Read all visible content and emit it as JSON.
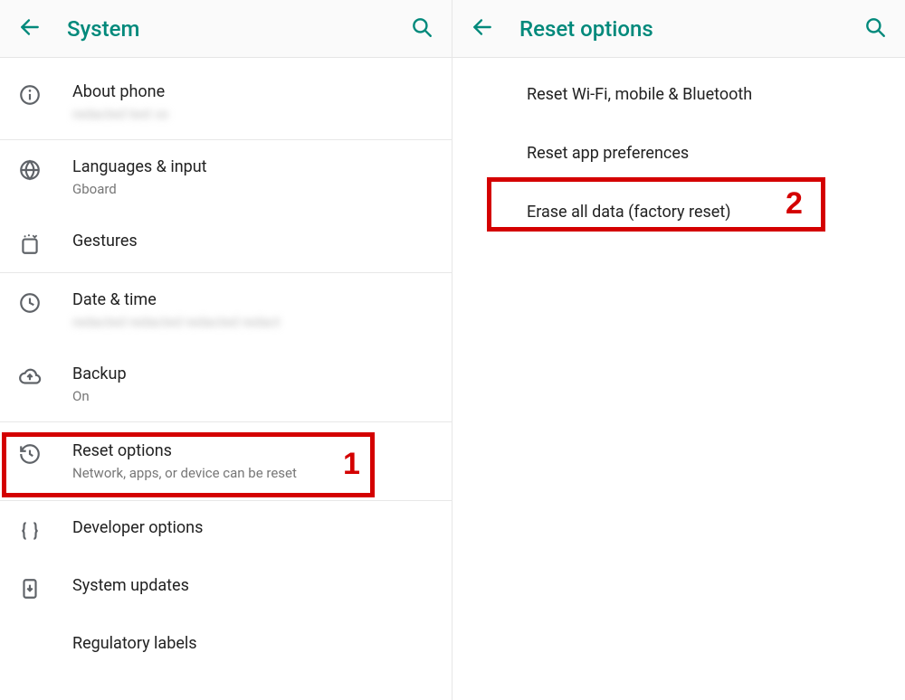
{
  "accent": "#00897b",
  "left": {
    "title": "System",
    "items": [
      {
        "icon": "info",
        "title": "About phone",
        "sub": "",
        "blurred": true
      },
      {
        "icon": "globe",
        "title": "Languages & input",
        "sub": "Gboard"
      },
      {
        "icon": "gestures",
        "title": "Gestures"
      },
      {
        "icon": "clock",
        "title": "Date & time",
        "sub": "",
        "blurred": true
      },
      {
        "icon": "cloud",
        "title": "Backup",
        "sub": "On"
      },
      {
        "icon": "restore",
        "title": "Reset options",
        "sub": "Network, apps, or device can be reset",
        "highlight": 1
      },
      {
        "icon": "braces",
        "title": "Developer options"
      },
      {
        "icon": "update",
        "title": "System updates"
      },
      {
        "icon": "blank",
        "title": "Regulatory labels"
      }
    ]
  },
  "right": {
    "title": "Reset options",
    "items": [
      {
        "title": "Reset Wi-Fi, mobile & Bluetooth"
      },
      {
        "title": "Reset app preferences"
      },
      {
        "title": "Erase all data (factory reset)",
        "highlight": 2
      }
    ]
  },
  "annotations": {
    "1": "1",
    "2": "2"
  }
}
